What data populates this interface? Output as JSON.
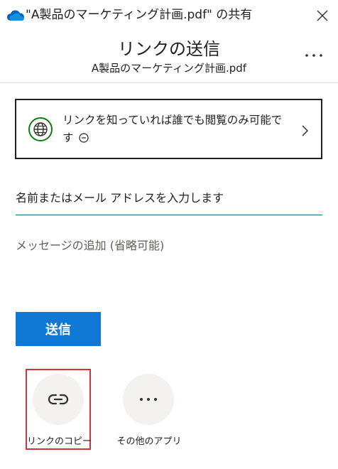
{
  "window": {
    "title": "\"A製品のマーケティング計画.pdf\" の共有",
    "close_icon": "close-icon",
    "app_icon": "onedrive-cloud-icon"
  },
  "header": {
    "title": "リンクの送信",
    "subtitle": "A製品のマーケティング計画.pdf",
    "more_icon": "more-options-icon"
  },
  "link_settings": {
    "line1": "リンクを知っていれば誰でも閲覧のみ可能で",
    "line2": "す",
    "icon": "globe-icon",
    "status_icon": "minus-circle-icon",
    "chevron_icon": "chevron-right-icon"
  },
  "recipients": {
    "placeholder": "名前またはメール アドレスを入力します",
    "value": ""
  },
  "message": {
    "placeholder": "メッセージの追加 (省略可能)",
    "value": ""
  },
  "send_button": {
    "label": "送信"
  },
  "share_options": [
    {
      "label": "リンクのコピー",
      "icon": "link-icon"
    },
    {
      "label": "その他のアプリ",
      "icon": "more-apps-icon"
    }
  ],
  "colors": {
    "accent": "#0f78d4",
    "globe": "#107c10",
    "input_underline": "#0f6f74",
    "highlight_border": "#d13438",
    "option_bg": "#f3f2f1"
  }
}
